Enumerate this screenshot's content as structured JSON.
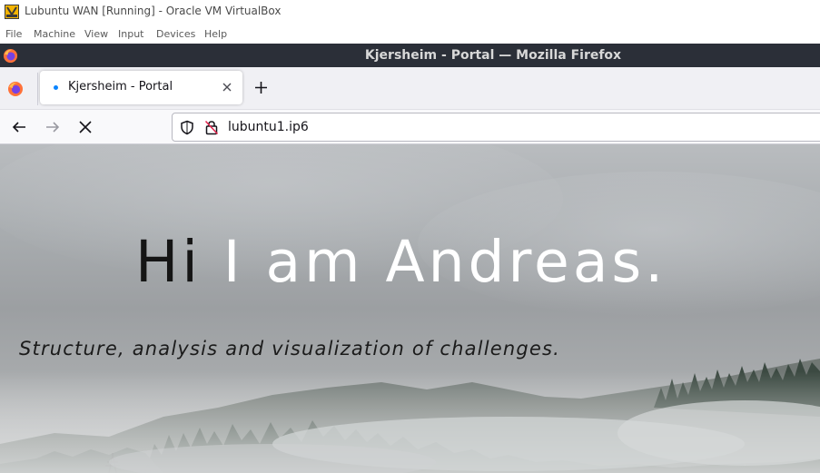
{
  "vbox": {
    "title": "Lubuntu WAN [Running] - Oracle VM VirtualBox",
    "menu": [
      "File",
      "Machine",
      "View",
      "Input",
      "Devices",
      "Help"
    ]
  },
  "firefox": {
    "window_title": "Kjersheim - Portal — Mozilla Firefox",
    "tab": {
      "label": "Kjersheim - Portal",
      "state": "loading"
    },
    "url": "lubuntu1.ip6",
    "icons": [
      "firefox-logo",
      "back-arrow",
      "forward-arrow",
      "stop-x",
      "shield",
      "insecure-lock",
      "close-x",
      "plus"
    ]
  },
  "page": {
    "heading_hi": "Hi",
    "heading_name": " I am Andreas.",
    "subtitle": "Structure, analysis and visualization of challenges."
  },
  "colors": {
    "ff_titlebar": "#2b2f38",
    "tab_loading_dot": "#0a84ff",
    "hero_hi": "#151515",
    "hero_name": "#ffffff"
  }
}
